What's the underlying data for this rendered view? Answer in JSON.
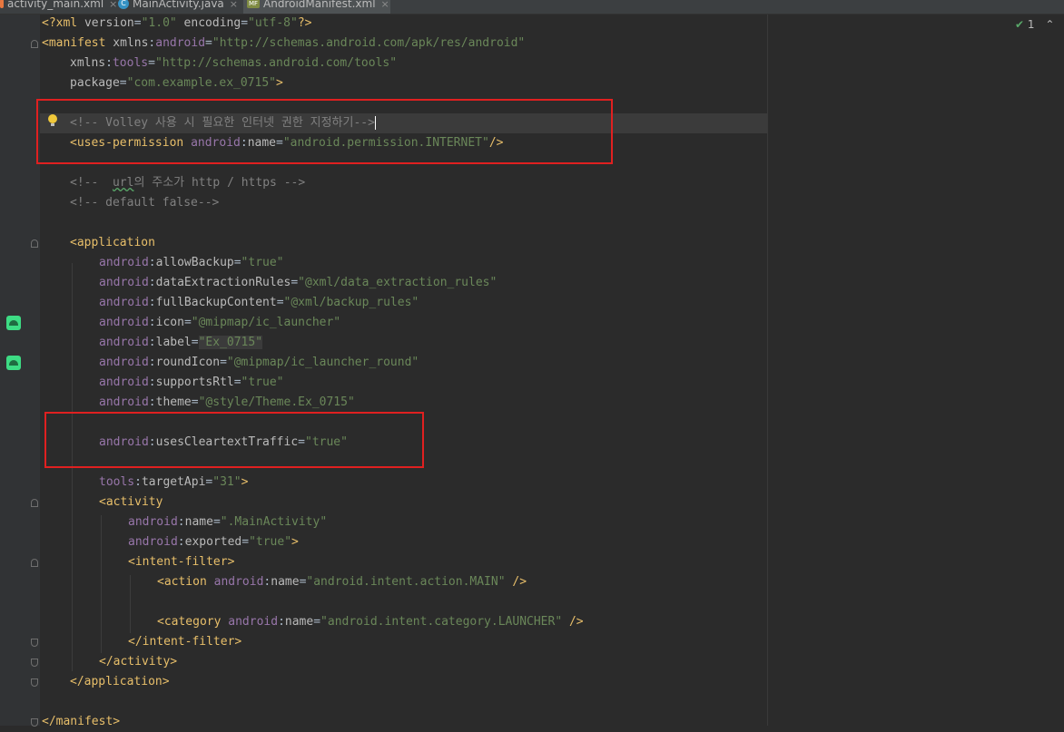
{
  "tabs": [
    {
      "label": "activity_main.xml",
      "close": "×"
    },
    {
      "label": "MainActivity.java",
      "close": "×"
    },
    {
      "label": "AndroidManifest.xml",
      "close": "×"
    }
  ],
  "inspection": {
    "count": "1",
    "check": "✔",
    "chevron": "⌃"
  },
  "code": {
    "l1": {
      "pi_open": "<?xml ",
      "a1": "version",
      "v1": "\"1.0\"",
      "a2": " encoding",
      "v2": "\"utf-8\"",
      "pi_close": "?>"
    },
    "l2": {
      "tag": "<manifest ",
      "ns": "xmlns",
      "colon": ":",
      "name": "android",
      "eq": "=",
      "val": "\"http://schemas.android.com/apk/res/android\""
    },
    "l3": {
      "ns": "xmlns",
      "colon": ":",
      "name": "tools",
      "eq": "=",
      "val": "\"http://schemas.android.com/tools\""
    },
    "l4": {
      "attr": "package",
      "eq": "=",
      "val": "\"com.example.ex_0715\"",
      "close": ">"
    },
    "l6": {
      "comment": "<!-- Volley 사용 시 필요한 인터넷 권한 지정하기-->"
    },
    "l7": {
      "tag": "<uses-permission ",
      "ns": "android",
      "colon": ":",
      "attr": "name",
      "eq": "=",
      "val": "\"android.permission.INTERNET\"",
      "close": "/>"
    },
    "l9": {
      "c1": "<!--  ",
      "url": "url",
      "c2": "의 주소가 http / https -->"
    },
    "l10": {
      "comment": "<!-- default false-->"
    },
    "l12": {
      "tag": "<application"
    },
    "attrs": [
      {
        "ns": "android",
        "attr": "allowBackup",
        "val": "\"true\""
      },
      {
        "ns": "android",
        "attr": "dataExtractionRules",
        "val": "\"@xml/data_extraction_rules\""
      },
      {
        "ns": "android",
        "attr": "fullBackupContent",
        "val": "\"@xml/backup_rules\""
      },
      {
        "ns": "android",
        "attr": "icon",
        "val": "\"@mipmap/ic_launcher\""
      },
      {
        "ns": "android",
        "attr": "label",
        "val": "\"Ex_0715\""
      },
      {
        "ns": "android",
        "attr": "roundIcon",
        "val": "\"@mipmap/ic_launcher_round\""
      },
      {
        "ns": "android",
        "attr": "supportsRtl",
        "val": "\"true\""
      },
      {
        "ns": "android",
        "attr": "theme",
        "val": "\"@style/Theme.Ex_0715\""
      }
    ],
    "l22": {
      "ns": "android",
      "colon": ":",
      "attr": "usesCleartextTraffic",
      "eq": "=",
      "val": "\"true\""
    },
    "l24": {
      "ns": "tools",
      "colon": ":",
      "attr": "targetApi",
      "eq": "=",
      "val": "\"31\"",
      "close": ">"
    },
    "l25": {
      "tag": "<activity"
    },
    "l26": {
      "ns": "android",
      "colon": ":",
      "attr": "name",
      "eq": "=",
      "val": "\".MainActivity\""
    },
    "l27": {
      "ns": "android",
      "colon": ":",
      "attr": "exported",
      "eq": "=",
      "val": "\"true\"",
      "close": ">"
    },
    "l28": {
      "tag": "<intent-filter>"
    },
    "l29": {
      "tag": "<action ",
      "ns": "android",
      "colon": ":",
      "attr": "name",
      "eq": "=",
      "val": "\"android.intent.action.MAIN\"",
      "close": " />"
    },
    "l31": {
      "tag": "<category ",
      "ns": "android",
      "colon": ":",
      "attr": "name",
      "eq": "=",
      "val": "\"android.intent.category.LAUNCHER\"",
      "close": " />"
    },
    "l32": {
      "tag": "</intent-filter>"
    },
    "l33": {
      "tag": "</activity>"
    },
    "l34": {
      "tag": "</application>"
    },
    "l36": {
      "tag": "</manifest>"
    }
  },
  "colors": {
    "tag": "#e8bf6a",
    "namespace": "#9876aa",
    "value": "#6a8759",
    "comment": "#808080",
    "annotation_box": "#e02020"
  }
}
